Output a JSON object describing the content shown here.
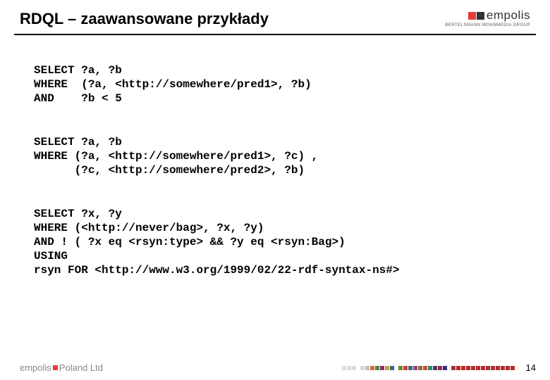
{
  "header": {
    "title": "RDQL – zaawansowane przykłady",
    "logo_text": "empolis",
    "logo_sub": "BERTELSMANN MOHNMEDIA GROUP"
  },
  "code": {
    "block1": "SELECT ?a, ?b\nWHERE  (?a, <http://somewhere/pred1>, ?b)\nAND    ?b < 5",
    "block2": "SELECT ?a, ?b\nWHERE (?a, <http://somewhere/pred1>, ?c) ,\n      (?c, <http://somewhere/pred2>, ?b)",
    "block3": "SELECT ?x, ?y\nWHERE (<http://never/bag>, ?x, ?y)\nAND ! ( ?x eq <rsyn:type> && ?y eq <rsyn:Bag>)\nUSING\nrsyn FOR <http://www.w3.org/1999/02/22-rdf-syntax-ns#>"
  },
  "footer": {
    "brand_a": "empolis",
    "brand_b": "Poland Ltd",
    "page": "14",
    "colors": [
      "#dcdcdc",
      "#dcdcdc",
      "#dcdcdc",
      "#ffffff",
      "#d9d9d9",
      "#bcbcbc",
      "#d96c2e",
      "#4a8a3a",
      "#8a2e6c",
      "#c9a23a",
      "#2e6c8a",
      "#ffffff",
      "#6c8a2e",
      "#c93a3a",
      "#3a6c8a",
      "#a23a8a",
      "#8a6c2e",
      "#c9572e",
      "#2e8a6c",
      "#572e8a",
      "#8a2e2e",
      "#2e2e8a",
      "#ffffff",
      "#b22e2e",
      "#b22e2e",
      "#b22e2e",
      "#b22e2e",
      "#b22e2e",
      "#b22e2e",
      "#b22e2e",
      "#b22e2e",
      "#b22e2e",
      "#b22e2e",
      "#b22e2e",
      "#b22e2e",
      "#b22e2e"
    ]
  }
}
